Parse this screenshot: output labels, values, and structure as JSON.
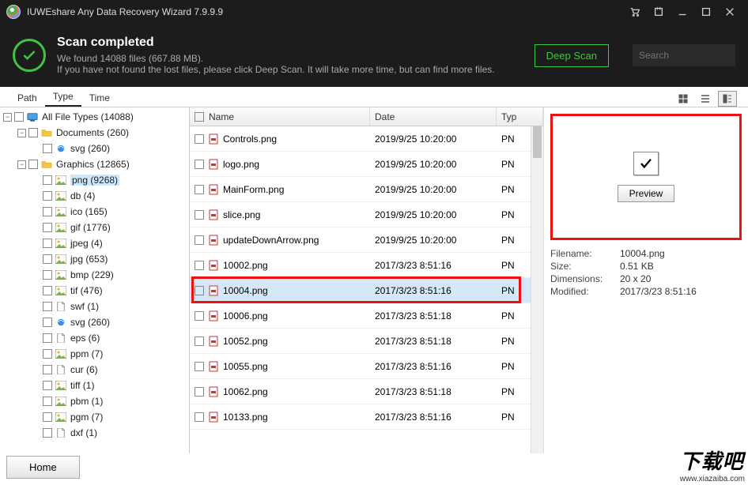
{
  "app": {
    "title": "IUWEshare Any Data Recovery Wizard 7.9.9.9"
  },
  "header": {
    "title": "Scan completed",
    "line1": "We found 14088 files (667.88 MB).",
    "line2": "If you have not found the lost files, please click Deep Scan. It will take more time, but can find more files.",
    "deep_scan": "Deep Scan"
  },
  "search": {
    "placeholder": "Search"
  },
  "tabs": {
    "path": "Path",
    "type": "Type",
    "time": "Time"
  },
  "tree": [
    {
      "indent": 0,
      "exp": "-",
      "icon": "device",
      "label": "All File Types (14088)"
    },
    {
      "indent": 1,
      "exp": "-",
      "icon": "folder",
      "label": "Documents (260)"
    },
    {
      "indent": 2,
      "exp": "",
      "icon": "ie",
      "label": "svg (260)"
    },
    {
      "indent": 1,
      "exp": "-",
      "icon": "folder",
      "label": "Graphics (12865)"
    },
    {
      "indent": 2,
      "exp": "",
      "icon": "pic",
      "label": "png (9268)",
      "selected": true
    },
    {
      "indent": 2,
      "exp": "",
      "icon": "pic",
      "label": "db (4)"
    },
    {
      "indent": 2,
      "exp": "",
      "icon": "pic",
      "label": "ico (165)"
    },
    {
      "indent": 2,
      "exp": "",
      "icon": "pic",
      "label": "gif (1776)"
    },
    {
      "indent": 2,
      "exp": "",
      "icon": "pic",
      "label": "jpeg (4)"
    },
    {
      "indent": 2,
      "exp": "",
      "icon": "pic",
      "label": "jpg (653)"
    },
    {
      "indent": 2,
      "exp": "",
      "icon": "pic",
      "label": "bmp (229)"
    },
    {
      "indent": 2,
      "exp": "",
      "icon": "pic",
      "label": "tif (476)"
    },
    {
      "indent": 2,
      "exp": "",
      "icon": "file",
      "label": "swf (1)"
    },
    {
      "indent": 2,
      "exp": "",
      "icon": "ie",
      "label": "svg (260)"
    },
    {
      "indent": 2,
      "exp": "",
      "icon": "file",
      "label": "eps (6)"
    },
    {
      "indent": 2,
      "exp": "",
      "icon": "pic",
      "label": "ppm (7)"
    },
    {
      "indent": 2,
      "exp": "",
      "icon": "file",
      "label": "cur (6)"
    },
    {
      "indent": 2,
      "exp": "",
      "icon": "pic",
      "label": "tiff (1)"
    },
    {
      "indent": 2,
      "exp": "",
      "icon": "pic",
      "label": "pbm (1)"
    },
    {
      "indent": 2,
      "exp": "",
      "icon": "pic",
      "label": "pgm (7)"
    },
    {
      "indent": 2,
      "exp": "",
      "icon": "file",
      "label": "dxf (1)"
    }
  ],
  "columns": {
    "name": "Name",
    "date": "Date",
    "type": "Typ"
  },
  "rows": [
    {
      "name": "Controls.png",
      "date": "2019/9/25 10:20:00",
      "type": "PN"
    },
    {
      "name": "logo.png",
      "date": "2019/9/25 10:20:00",
      "type": "PN"
    },
    {
      "name": "MainForm.png",
      "date": "2019/9/25 10:20:00",
      "type": "PN"
    },
    {
      "name": "slice.png",
      "date": "2019/9/25 10:20:00",
      "type": "PN"
    },
    {
      "name": "updateDownArrow.png",
      "date": "2019/9/25 10:20:00",
      "type": "PN"
    },
    {
      "name": "10002.png",
      "date": "2017/3/23 8:51:16",
      "type": "PN"
    },
    {
      "name": "10004.png",
      "date": "2017/3/23 8:51:16",
      "type": "PN",
      "selected": true
    },
    {
      "name": "10006.png",
      "date": "2017/3/23 8:51:18",
      "type": "PN"
    },
    {
      "name": "10052.png",
      "date": "2017/3/23 8:51:18",
      "type": "PN"
    },
    {
      "name": "10055.png",
      "date": "2017/3/23 8:51:16",
      "type": "PN"
    },
    {
      "name": "10062.png",
      "date": "2017/3/23 8:51:18",
      "type": "PN"
    },
    {
      "name": "10133.png",
      "date": "2017/3/23 8:51:16",
      "type": "PN"
    }
  ],
  "preview": {
    "button": "Preview",
    "labels": {
      "filename": "Filename:",
      "size": "Size:",
      "dimensions": "Dimensions:",
      "modified": "Modified:"
    },
    "values": {
      "filename": "10004.png",
      "size": "0.51 KB",
      "dimensions": "20 x 20",
      "modified": "2017/3/23 8:51:16"
    }
  },
  "bottom": {
    "home": "Home"
  },
  "watermark": {
    "big": "下载吧",
    "url": "www.xiazaiba.com"
  }
}
